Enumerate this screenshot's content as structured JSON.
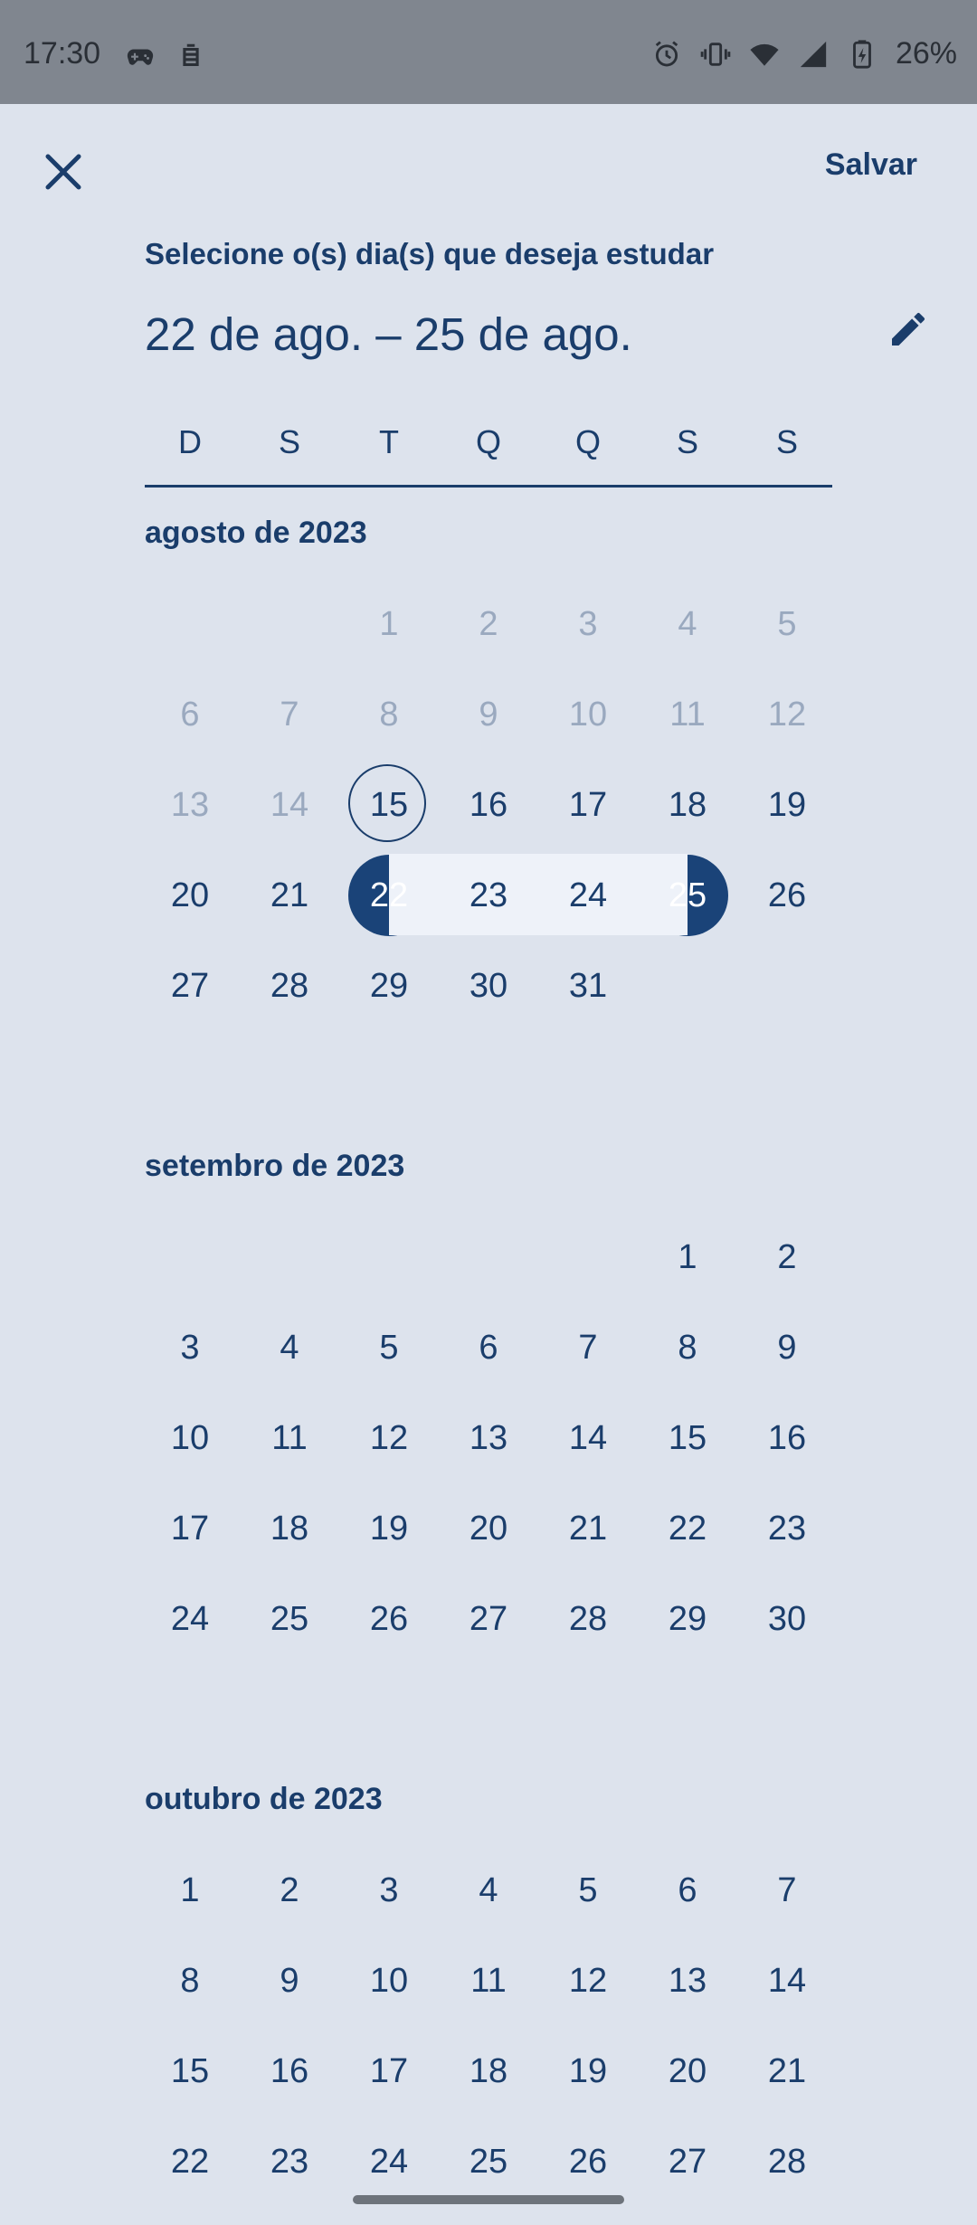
{
  "status_bar": {
    "time": "17:30",
    "battery": "26%",
    "left_icons": [
      "gamepad-icon",
      "robot-icon"
    ],
    "right_icons": [
      "alarm-icon",
      "vibrate-icon",
      "wifi-icon",
      "signal-icon",
      "battery-charging-icon"
    ]
  },
  "header": {
    "close_icon": "close-icon",
    "save_label": "Salvar",
    "subtitle": "Selecione o(s) dia(s) que deseja estudar",
    "range_title": "22 de ago. – 25 de ago.",
    "edit_icon": "pencil-icon"
  },
  "weekdays": [
    "D",
    "S",
    "T",
    "Q",
    "Q",
    "S",
    "S"
  ],
  "months": [
    {
      "label": "agosto de 2023",
      "weeks": [
        [
          "",
          "",
          "1",
          "2",
          "3",
          "4",
          "5"
        ],
        [
          "6",
          "7",
          "8",
          "9",
          "10",
          "11",
          "12"
        ],
        [
          "13",
          "14",
          "15",
          "16",
          "17",
          "18",
          "19"
        ],
        [
          "20",
          "21",
          "22",
          "23",
          "24",
          "25",
          "26"
        ],
        [
          "27",
          "28",
          "29",
          "30",
          "31",
          "",
          ""
        ]
      ]
    },
    {
      "label": "setembro de 2023",
      "weeks": [
        [
          "",
          "",
          "",
          "",
          "",
          "1",
          "2"
        ],
        [
          "3",
          "4",
          "5",
          "6",
          "7",
          "8",
          "9"
        ],
        [
          "10",
          "11",
          "12",
          "13",
          "14",
          "15",
          "16"
        ],
        [
          "17",
          "18",
          "19",
          "20",
          "21",
          "22",
          "23"
        ],
        [
          "24",
          "25",
          "26",
          "27",
          "28",
          "29",
          "30"
        ]
      ]
    },
    {
      "label": "outubro de 2023",
      "weeks": [
        [
          "1",
          "2",
          "3",
          "4",
          "5",
          "6",
          "7"
        ],
        [
          "8",
          "9",
          "10",
          "11",
          "12",
          "13",
          "14"
        ],
        [
          "15",
          "16",
          "17",
          "18",
          "19",
          "20",
          "21"
        ],
        [
          "22",
          "23",
          "24",
          "25",
          "26",
          "27",
          "28"
        ]
      ]
    }
  ],
  "selection": {
    "month": "agosto de 2023",
    "start_day": "22",
    "end_day": "25",
    "today": "15",
    "disabled_before": "15"
  },
  "colors": {
    "background": "#dde3ed",
    "primary": "#1a4378",
    "range": "#eef2f9",
    "disabled_text": "#9aa9bf",
    "status_bar": "#80868f"
  }
}
